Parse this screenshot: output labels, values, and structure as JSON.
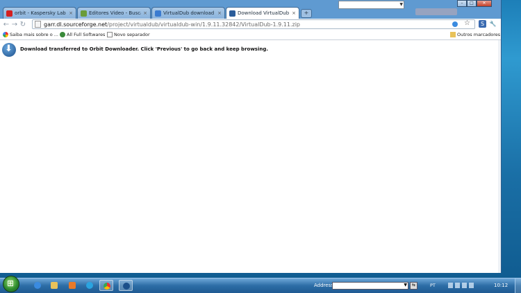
{
  "browser": {
    "tabs": [
      {
        "title": "orbit - Kaspersky Lab For...",
        "close": "×",
        "fav_color": "#d42020",
        "active": false
      },
      {
        "title": "Editores Video - Busca Ba...",
        "close": "×",
        "fav_color": "#6a9c3a",
        "active": false
      },
      {
        "title": "VirtualDub download - B...",
        "close": "×",
        "fav_color": "#3a7bd0",
        "active": false
      },
      {
        "title": "Download VirtualDub fro...",
        "close": "×",
        "fav_color": "#2a5c9a",
        "active": true
      }
    ],
    "new_tab": "+",
    "window_controls": {
      "minimize": "–",
      "maximize": "□",
      "close": "✕"
    },
    "nav": {
      "back": "←",
      "forward": "→",
      "reload": "↻"
    },
    "address": {
      "host": "garr.dl.sourceforge.net",
      "path": "/project/virtualdub/virtualdub-win/1.9.11.32842/VirtualDub-1.9.11.zip"
    },
    "star": "☆",
    "bookmarks": [
      {
        "label": "Saiba mais sobre o ...",
        "icon": "google-icon"
      },
      {
        "label": "All Full Softwares",
        "icon": "globe-icon"
      },
      {
        "label": "Novo separador",
        "icon": "page-icon"
      }
    ],
    "other_bookmarks": "Outros marcadores",
    "message": "Download transferred to Orbit Downloader. Click 'Previous' to go back and keep browsing."
  },
  "taskbar": {
    "start_glyph": "⊞",
    "address_label": "Address",
    "go_glyph": "⇆",
    "language": "PT",
    "clock": "10:12"
  },
  "colors": {
    "accent": "#2c6da6",
    "brand": "#4a87c8"
  }
}
